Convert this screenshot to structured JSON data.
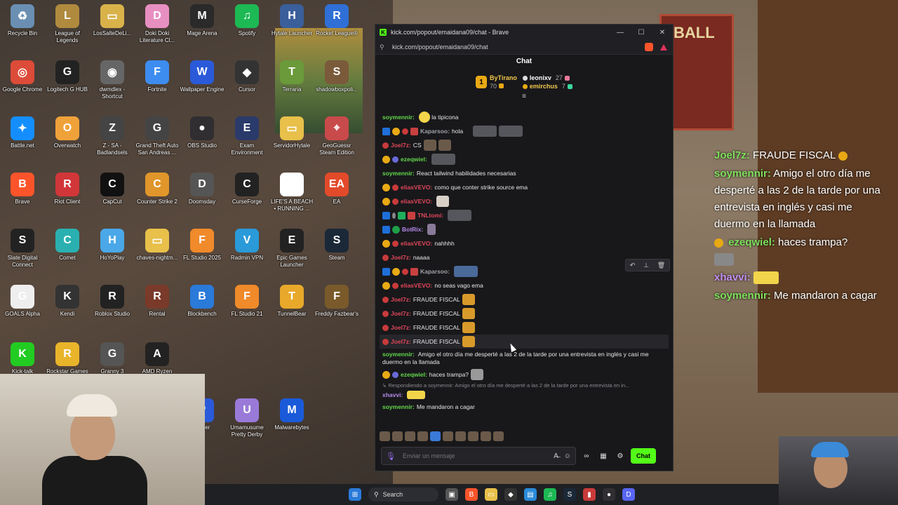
{
  "desktop_icons": [
    {
      "label": "Recycle Bin",
      "color": "#6a8fb3",
      "glyph": "♻"
    },
    {
      "label": "League of Legends",
      "color": "#b08a3e",
      "glyph": "L"
    },
    {
      "label": "LosSalteDeLi...",
      "color": "#d9b24a",
      "glyph": "▭"
    },
    {
      "label": "Doki Doki Literature Cl...",
      "color": "#e88fc2",
      "glyph": "D"
    },
    {
      "label": "Mage Arena",
      "color": "#2a2a2a",
      "glyph": "M"
    },
    {
      "label": "Spotify",
      "color": "#1db954",
      "glyph": "♫"
    },
    {
      "label": "Hytale Launcher",
      "color": "#3a5f9a",
      "glyph": "H"
    },
    {
      "label": "Rocket League®",
      "color": "#2f6fd6",
      "glyph": "R"
    },
    {
      "label": "Google Chrome",
      "color": "#dd4b39",
      "glyph": "◎"
    },
    {
      "label": "Logitech G HUB",
      "color": "#222",
      "glyph": "G"
    },
    {
      "label": "dwmdlex - Shortcut",
      "color": "#666",
      "glyph": "◉"
    },
    {
      "label": "Fortnite",
      "color": "#3d8df0",
      "glyph": "F"
    },
    {
      "label": "Wallpaper Engine",
      "color": "#2a5ad9",
      "glyph": "W"
    },
    {
      "label": "Cursor",
      "color": "#333",
      "glyph": "◆"
    },
    {
      "label": "Terraria",
      "color": "#6a9a3a",
      "glyph": "T"
    },
    {
      "label": "shadowboxpoli...",
      "color": "#7a5a3a",
      "glyph": "S"
    },
    {
      "label": "Battle.net",
      "color": "#148eff",
      "glyph": "✦"
    },
    {
      "label": "Overwatch",
      "color": "#f0a23a",
      "glyph": "O"
    },
    {
      "label": "Z - SA - Badlandsels",
      "color": "#444",
      "glyph": "Z"
    },
    {
      "label": "Grand Theft Auto San Andreas ...",
      "color": "#444",
      "glyph": "G"
    },
    {
      "label": "OBS Studio",
      "color": "#302e31",
      "glyph": "●"
    },
    {
      "label": "Exam Environment",
      "color": "#2a3a6a",
      "glyph": "E"
    },
    {
      "label": "ServidorHytale",
      "color": "#e8c04a",
      "glyph": "▭"
    },
    {
      "label": "GeoGuessr Steam Edition",
      "color": "#c94a4a",
      "glyph": "⌖"
    },
    {
      "label": "Brave",
      "color": "#fb542b",
      "glyph": "B"
    },
    {
      "label": "Riot Client",
      "color": "#d13639",
      "glyph": "R"
    },
    {
      "label": "CapCut",
      "color": "#111",
      "glyph": "C"
    },
    {
      "label": "Counter Strike 2",
      "color": "#e0962a",
      "glyph": "C"
    },
    {
      "label": "Doomsday",
      "color": "#555",
      "glyph": "D"
    },
    {
      "label": "CurseForge",
      "color": "#222",
      "glyph": "C"
    },
    {
      "label": "LIFE'S A BEACH • RUNNING ...",
      "color": "#fff",
      "glyph": "▲"
    },
    {
      "label": "EA",
      "color": "#e24a2a",
      "glyph": "EA"
    },
    {
      "label": "Slate Digital Connect",
      "color": "#222",
      "glyph": "S"
    },
    {
      "label": "Comet",
      "color": "#2ab0b0",
      "glyph": "C"
    },
    {
      "label": "HoYoPlay",
      "color": "#4aa8e8",
      "glyph": "H"
    },
    {
      "label": "chaves-nightm...",
      "color": "#e8c04a",
      "glyph": "▭"
    },
    {
      "label": "FL Studio 2025",
      "color": "#f08a2a",
      "glyph": "F"
    },
    {
      "label": "Radmin VPN",
      "color": "#2a9ad9",
      "glyph": "V"
    },
    {
      "label": "Epic Games Launcher",
      "color": "#222",
      "glyph": "E"
    },
    {
      "label": "Steam",
      "color": "#1b2838",
      "glyph": "S"
    },
    {
      "label": "GOALS Alpha",
      "color": "#eee",
      "glyph": "G"
    },
    {
      "label": "Kendi",
      "color": "#333",
      "glyph": "K"
    },
    {
      "label": "Roblox Studio",
      "color": "#222",
      "glyph": "R"
    },
    {
      "label": "Rental",
      "color": "#7a3a2a",
      "glyph": "R"
    },
    {
      "label": "Blockbench",
      "color": "#2a7ad9",
      "glyph": "B"
    },
    {
      "label": "FL Studio 21",
      "color": "#f08a2a",
      "glyph": "F"
    },
    {
      "label": "TunnelBear",
      "color": "#e8a82a",
      "glyph": "T"
    },
    {
      "label": "Freddy Fazbear's",
      "color": "#7a5a2a",
      "glyph": "F"
    },
    {
      "label": "Kick-talk",
      "color": "#22cc22",
      "glyph": "K"
    },
    {
      "label": "Rockstar Games Launcher",
      "color": "#e8b42a",
      "glyph": "R"
    },
    {
      "label": "Granny 3",
      "color": "#555",
      "glyph": "G"
    },
    {
      "label": "AMD Ryzen Master",
      "color": "#222",
      "glyph": "A"
    },
    {
      "label": "Player",
      "color": "#2a5ad9",
      "glyph": "P"
    },
    {
      "label": "Umamusume Pretty Derby",
      "color": "#9a7ad9",
      "glyph": "U"
    },
    {
      "label": "Malwarebytes",
      "color": "#1a5ad9",
      "glyph": "M"
    }
  ],
  "overlay": {
    "msg1_user": "Joel7z:",
    "msg1_text": "FRAUDE FISCAL",
    "msg2_user": "soymennir:",
    "msg2_text": "Amigo el otro día me desperté a las 2 de la tarde por una entrevista en inglés y casi me duermo en la llamada",
    "msg3_user": "ezeqwiel:",
    "msg3_text": "haces trampa?",
    "msg4_user": "xhavvi:",
    "msg5_user": "soymennir:",
    "msg5_text": "Me mandaron a cagar"
  },
  "window": {
    "title": "kick.com/popout/emaidana09/chat - Brave",
    "url": "kick.com/popout/emaidana09/chat",
    "minimize": "—",
    "maximize": "☐",
    "close": "✕"
  },
  "chat": {
    "header": "Chat",
    "leaders": {
      "main_name": "ByTirano",
      "main_count": "70",
      "second_name": "leonixv",
      "second_count": "27",
      "third_name": "emirchus",
      "third_count": "7"
    },
    "messages": [
      {
        "user": "soymennir:",
        "text": "la tipicona"
      },
      {
        "user": "Kaparsoo:",
        "text": "hola"
      },
      {
        "user": "Joel7z:",
        "text": "CS"
      },
      {
        "user": "ezeqwiel:",
        "text": ""
      },
      {
        "user": "soymennir:",
        "text": "React tailwind habilidades necesarias"
      },
      {
        "user": "eliasVEVO:",
        "text": "como que conter strike source ema"
      },
      {
        "user": "eliasVEVO:",
        "text": ""
      },
      {
        "user": "TNLtomi:",
        "text": ""
      },
      {
        "user": "BotRix:",
        "text": ""
      },
      {
        "user": "eliasVEVO:",
        "text": "nahhhh"
      },
      {
        "user": "Joel7z:",
        "text": "naaaa"
      },
      {
        "user": "Kaparsoo:",
        "text": ""
      },
      {
        "user": "eliasVEVO:",
        "text": "no seas vago ema"
      },
      {
        "user": "Joel7z:",
        "text": "FRAUDE FISCAL"
      },
      {
        "user": "Joel7z:",
        "text": "FRAUDE FISCAL"
      },
      {
        "user": "Joel7z:",
        "text": "FRAUDE FISCAL"
      },
      {
        "user": "Joel7z:",
        "text": "FRAUDE FISCAL"
      },
      {
        "user": "soymennir:",
        "text": "Amigo el otro día me desperté a las 2 de la tarde por una entrevista en inglés y casi me duermo en la llamada"
      },
      {
        "user": "ezeqwiel:",
        "text": "haces trampa?"
      },
      {
        "user": "xhavvi:",
        "text": ""
      },
      {
        "user": "soymennir:",
        "text": "Me mandaron a cagar"
      }
    ],
    "reply_text": "Respondiendo a soymennir: Amigo el otro día me desperté a las 2 de la tarde por una entrevista en in...",
    "input_placeholder": "Enviar un mensaje",
    "send_label": "Chat"
  },
  "taskbar": {
    "search_label": "Search"
  }
}
